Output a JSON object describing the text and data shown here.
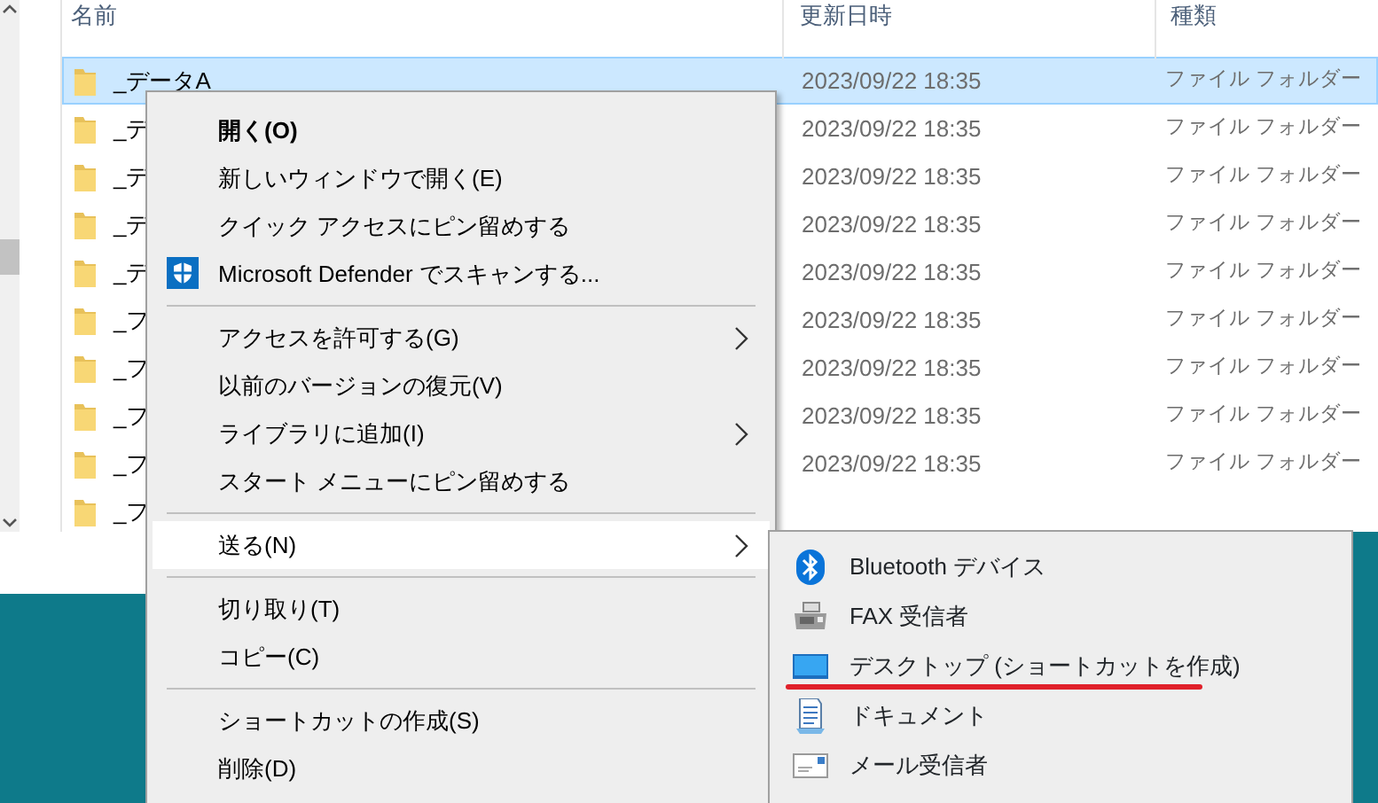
{
  "columns": [
    "名前",
    "更新日時",
    "種類"
  ],
  "rows": [
    {
      "name": "_データA",
      "date": "2023/09/22 18:35",
      "type": "ファイル フォルダー",
      "selected": true
    },
    {
      "name": "_デ",
      "date": "2023/09/22 18:35",
      "type": "ファイル フォルダー",
      "selected": false
    },
    {
      "name": "_デ",
      "date": "2023/09/22 18:35",
      "type": "ファイル フォルダー",
      "selected": false
    },
    {
      "name": "_デ",
      "date": "2023/09/22 18:35",
      "type": "ファイル フォルダー",
      "selected": false
    },
    {
      "name": "_デ",
      "date": "2023/09/22 18:35",
      "type": "ファイル フォルダー",
      "selected": false
    },
    {
      "name": "_フ",
      "date": "2023/09/22 18:35",
      "type": "ファイル フォルダー",
      "selected": false
    },
    {
      "name": "_フ",
      "date": "2023/09/22 18:35",
      "type": "ファイル フォルダー",
      "selected": false
    },
    {
      "name": "_フ",
      "date": "2023/09/22 18:35",
      "type": "ファイル フォルダー",
      "selected": false
    },
    {
      "name": "_フ",
      "date": "2023/09/22 18:35",
      "type": "ファイル フォルダー",
      "selected": false
    },
    {
      "name": "_フ",
      "selected": false
    }
  ],
  "context_menu": [
    {
      "kind": "item",
      "label": "開く(O)",
      "bold": true,
      "submenu": false,
      "selected": false
    },
    {
      "kind": "item",
      "label": "新しいウィンドウで開く(E)",
      "submenu": false,
      "selected": false
    },
    {
      "kind": "item",
      "label": "クイック アクセスにピン留めする",
      "submenu": false,
      "selected": false
    },
    {
      "kind": "item",
      "label": "Microsoft Defender でスキャンする...",
      "has_icon": true,
      "submenu": false,
      "selected": false
    },
    {
      "kind": "separator"
    },
    {
      "kind": "item",
      "label": "アクセスを許可する(G)",
      "submenu": true,
      "selected": false
    },
    {
      "kind": "item",
      "label": "以前のバージョンの復元(V)",
      "submenu": false,
      "selected": false
    },
    {
      "kind": "item",
      "label": "ライブラリに追加(I)",
      "submenu": true,
      "selected": false
    },
    {
      "kind": "item",
      "label": "スタート メニューにピン留めする",
      "submenu": false,
      "selected": false
    },
    {
      "kind": "separator"
    },
    {
      "kind": "item",
      "label": "送る(N)",
      "submenu": true,
      "selected": true
    },
    {
      "kind": "separator"
    },
    {
      "kind": "item",
      "label": "切り取り(T)",
      "submenu": false,
      "selected": false
    },
    {
      "kind": "item",
      "label": "コピー(C)",
      "submenu": false,
      "selected": false
    },
    {
      "kind": "separator"
    },
    {
      "kind": "item",
      "label": "ショートカットの作成(S)",
      "submenu": false,
      "selected": false
    },
    {
      "kind": "item",
      "label": "削除(D)",
      "submenu": false,
      "selected": false
    }
  ],
  "send_to_menu": [
    {
      "label": "Bluetooth デバイス",
      "underlined": false
    },
    {
      "label": "FAX 受信者",
      "underlined": false
    },
    {
      "label": "デスクトップ (ショートカットを作成)",
      "underlined": true
    },
    {
      "label": "ドキュメント",
      "underlined": false
    },
    {
      "label": "メール受信者",
      "underlined": false
    }
  ]
}
